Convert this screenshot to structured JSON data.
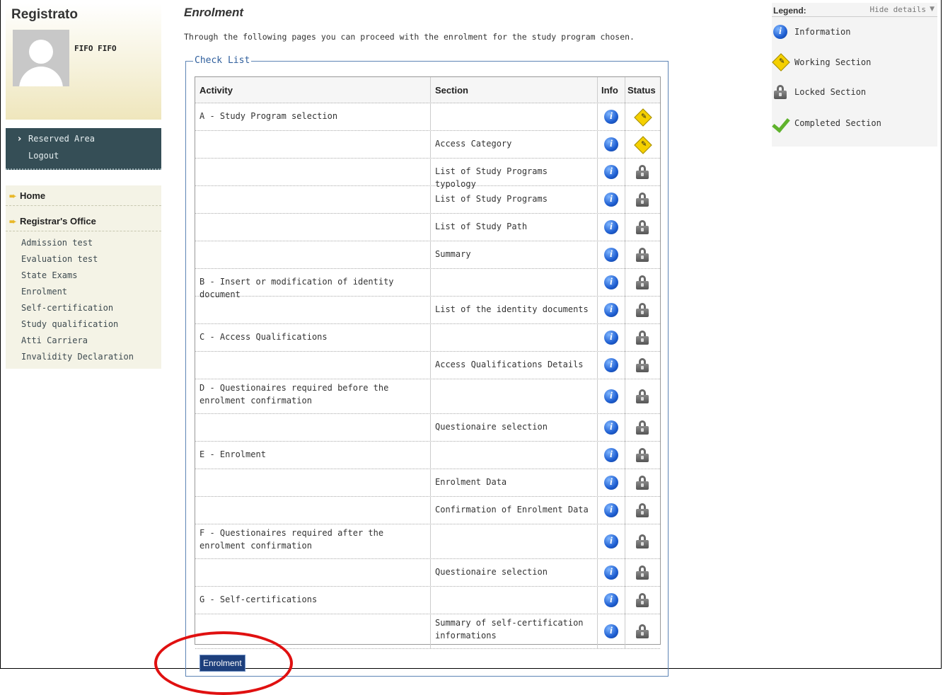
{
  "sidebar": {
    "title": "Registrato",
    "user_name": "FIFO FIFO",
    "reserved": {
      "reserved_area": "Reserved Area",
      "logout": "Logout"
    },
    "nav": {
      "home": "Home",
      "registrar": "Registrar's Office",
      "sub_items": [
        "Admission test",
        "Evaluation test",
        "State Exams",
        "Enrolment",
        "Self-certification",
        "Study qualification",
        "Atti Carriera",
        "Invalidity Declaration"
      ]
    }
  },
  "main": {
    "title": "Enrolment",
    "intro": "Through the following pages you can proceed with the enrolment for the study program chosen.",
    "checklist_legend": "Check List",
    "headers": {
      "activity": "Activity",
      "section": "Section",
      "info": "Info",
      "status": "Status"
    },
    "rows": [
      {
        "activity": "A - Study Program selection",
        "section": "",
        "status": "working"
      },
      {
        "activity": "",
        "section": "Access Category",
        "status": "working"
      },
      {
        "activity": "",
        "section": "List of Study Programs typology",
        "status": "locked"
      },
      {
        "activity": "",
        "section": "List of Study Programs",
        "status": "locked"
      },
      {
        "activity": "",
        "section": "List of Study Path",
        "status": "locked"
      },
      {
        "activity": "",
        "section": "Summary",
        "status": "locked"
      },
      {
        "activity": "B - Insert or modification of identity document",
        "section": "",
        "status": "locked"
      },
      {
        "activity": "",
        "section": "List of the identity documents",
        "status": "locked"
      },
      {
        "activity": "C - Access Qualifications",
        "section": "",
        "status": "locked"
      },
      {
        "activity": "",
        "section": "Access Qualifications Details",
        "status": "locked"
      },
      {
        "activity": "D - Questionaires required before the enrolment confirmation",
        "section": "",
        "status": "locked"
      },
      {
        "activity": "",
        "section": "Questionaire selection",
        "status": "locked"
      },
      {
        "activity": "E - Enrolment",
        "section": "",
        "status": "locked"
      },
      {
        "activity": "",
        "section": "Enrolment Data",
        "status": "locked"
      },
      {
        "activity": "",
        "section": "Confirmation of Enrolment Data",
        "status": "locked"
      },
      {
        "activity": "F - Questionaires required after the enrolment confirmation",
        "section": "",
        "status": "locked"
      },
      {
        "activity": "",
        "section": "Questionaire selection",
        "status": "locked"
      },
      {
        "activity": "G - Self-certifications",
        "section": "",
        "status": "locked"
      },
      {
        "activity": "",
        "section": "Summary of self-certification informations",
        "status": "locked"
      }
    ],
    "enrol_button": "Enrolment"
  },
  "legend": {
    "title": "Legend:",
    "hide": "Hide details",
    "items": [
      "Information",
      "Working Section",
      "Locked Section",
      "Completed Section"
    ]
  }
}
